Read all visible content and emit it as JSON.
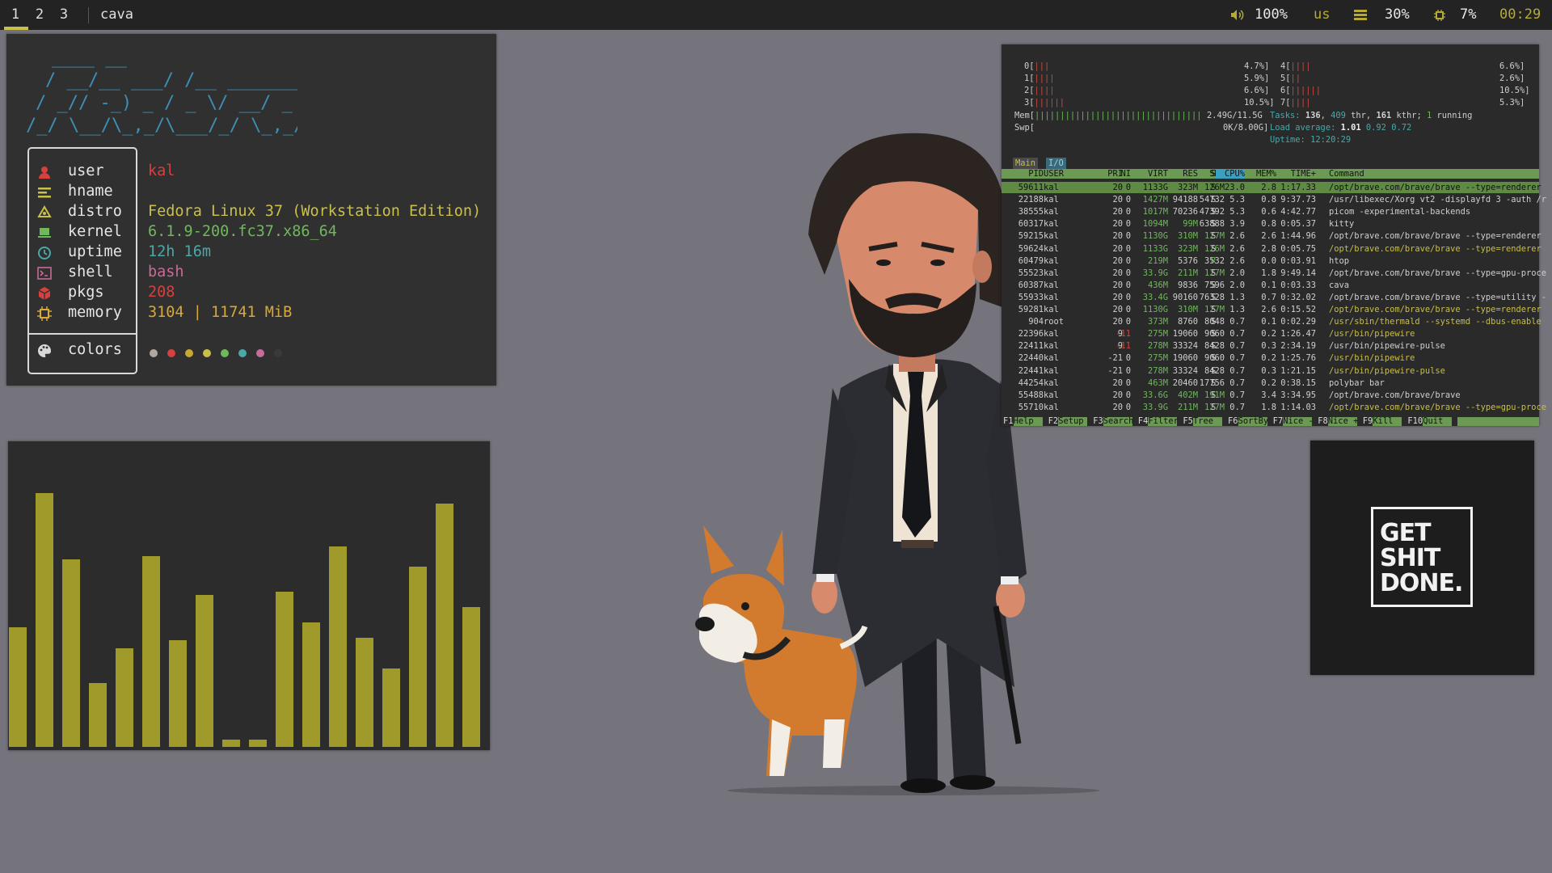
{
  "bar": {
    "workspaces": [
      "1",
      "2",
      "3"
    ],
    "window_title": "cava",
    "volume": "100%",
    "layout": "us",
    "memory": "30%",
    "cpu": "7%",
    "clock": "00:29",
    "accent": "#c9c04a"
  },
  "fetch": {
    "rows": [
      {
        "label": "user",
        "value": "kal",
        "icon": "user-icon",
        "color": "#d5413e"
      },
      {
        "label": "hname",
        "value": "",
        "icon": "hostname-icon",
        "color": "#c9c04a"
      },
      {
        "label": "distro",
        "value": "Fedora Linux 37 (Workstation Edition)",
        "icon": "fedora-icon",
        "color": "#c9c04a"
      },
      {
        "label": "kernel",
        "value": "6.1.9-200.fc37.x86_64",
        "icon": "laptop-icon",
        "color": "#6fb85c"
      },
      {
        "label": "uptime",
        "value": "12h 16m",
        "icon": "clock-icon",
        "color": "#4aa8a8"
      },
      {
        "label": "shell",
        "value": "bash",
        "icon": "terminal-icon",
        "color": "#c76b98"
      },
      {
        "label": "pkgs",
        "value": "208",
        "icon": "package-icon",
        "color": "#d5413e"
      },
      {
        "label": "memory",
        "value": "3104 | 11741 MiB",
        "icon": "chip-icon",
        "color": "#d8a838"
      }
    ],
    "colors_label": "colors",
    "palette": [
      "#b0a8a0",
      "#d5413e",
      "#c9a832",
      "#c9c04a",
      "#6fb85c",
      "#4aa8a8",
      "#c76b98",
      "#3a3a3a"
    ]
  },
  "cava": {
    "bar_color": "#a09a2a",
    "levels": [
      0.47,
      1.0,
      0.74,
      0.25,
      0.39,
      0.75,
      0.42,
      0.6,
      0.03,
      0.03,
      0.61,
      0.49,
      0.79,
      0.43,
      0.31,
      0.71,
      0.96,
      0.55
    ]
  },
  "htop": {
    "cpus": [
      {
        "id": "0",
        "bars": "|||",
        "pct": "4.7%"
      },
      {
        "id": "1",
        "bars": "||||",
        "pct": "5.9%"
      },
      {
        "id": "2",
        "bars": "||||",
        "pct": "6.6%"
      },
      {
        "id": "3",
        "bars": "||||||",
        "pct": "10.5%"
      },
      {
        "id": "4",
        "bars": "||||",
        "pct": "6.6%"
      },
      {
        "id": "5",
        "bars": "||",
        "pct": "2.6%"
      },
      {
        "id": "6",
        "bars": "||||||",
        "pct": "10.5%"
      },
      {
        "id": "7",
        "bars": "||||",
        "pct": "5.3%"
      }
    ],
    "mem_bars": "|||||||||||||||||||||||||||||||||",
    "mem": "2.49G/11.5G",
    "swp": "0K/8.00G",
    "tasks_label": "Tasks:",
    "tasks": "136",
    "thr": "409",
    "kthr": "161",
    "running": "1",
    "load_label": "Load average:",
    "load1": "1.01",
    "load5": "0.92",
    "load15": "0.72",
    "uptime_label": "Uptime:",
    "uptime": "12:20:29",
    "tabs": [
      "Main",
      "I/O"
    ],
    "header": [
      "PID",
      "USER",
      "PRI",
      "NI",
      "VIRT",
      "RES",
      "SHR",
      "S",
      "CPU%",
      "MEM%",
      "TIME+",
      "Command"
    ],
    "rows": [
      [
        "59611",
        "kal",
        "20",
        "0",
        "1133G",
        "323M",
        "126M",
        "S",
        "23.0",
        "2.8",
        "1:17.33",
        "/opt/brave.com/brave/brave --type=renderer"
      ],
      [
        "22188",
        "kal",
        "20",
        "0",
        "1427M",
        "94188",
        "54732",
        "S",
        "5.3",
        "0.8",
        "9:37.73",
        "/usr/libexec/Xorg vt2 -displayfd 3 -auth /r"
      ],
      [
        "38555",
        "kal",
        "20",
        "0",
        "1017M",
        "70236",
        "47392",
        "S",
        "5.3",
        "0.6",
        "4:42.77",
        "picom -experimental-backends"
      ],
      [
        "60317",
        "kal",
        "20",
        "0",
        "1094M",
        "99M",
        "63888",
        "S",
        "3.9",
        "0.8",
        "0:05.37",
        "kitty"
      ],
      [
        "59215",
        "kal",
        "20",
        "0",
        "1130G",
        "310M",
        "127M",
        "S",
        "2.6",
        "2.6",
        "1:44.96",
        "/opt/brave.com/brave/brave --type=renderer"
      ],
      [
        "59624",
        "kal",
        "20",
        "0",
        "1133G",
        "323M",
        "126M",
        "S",
        "2.6",
        "2.8",
        "0:05.75",
        "/opt/brave.com/brave/brave --type=renderer"
      ],
      [
        "60479",
        "kal",
        "20",
        "0",
        "219M",
        "5376",
        "3532",
        "R",
        "2.6",
        "0.0",
        "0:03.91",
        "htop"
      ],
      [
        "55523",
        "kal",
        "20",
        "0",
        "33.9G",
        "211M",
        "127M",
        "S",
        "2.0",
        "1.8",
        "9:49.14",
        "/opt/brave.com/brave/brave --type=gpu-proce"
      ],
      [
        "60387",
        "kal",
        "20",
        "0",
        "436M",
        "9836",
        "7596",
        "S",
        "2.0",
        "0.1",
        "0:03.33",
        "cava"
      ],
      [
        "55933",
        "kal",
        "20",
        "0",
        "33.4G",
        "90160",
        "76328",
        "S",
        "1.3",
        "0.7",
        "0:32.02",
        "/opt/brave.com/brave/brave --type=utility -"
      ],
      [
        "59281",
        "kal",
        "20",
        "0",
        "1130G",
        "310M",
        "127M",
        "S",
        "1.3",
        "2.6",
        "0:15.52",
        "/opt/brave.com/brave/brave --type=renderer"
      ],
      [
        "904",
        "root",
        "20",
        "0",
        "373M",
        "8760",
        "8048",
        "S",
        "0.7",
        "0.1",
        "0:02.29",
        "/usr/sbin/thermald --systemd --dbus-enable"
      ],
      [
        "22396",
        "kal",
        "9",
        "-11",
        "275M",
        "19060",
        "9060",
        "S",
        "0.7",
        "0.2",
        "1:26.47",
        "/usr/bin/pipewire"
      ],
      [
        "22411",
        "kal",
        "9",
        "-11",
        "278M",
        "33324",
        "8428",
        "S",
        "0.7",
        "0.3",
        "2:34.19",
        "/usr/bin/pipewire-pulse"
      ],
      [
        "22440",
        "kal",
        "-21",
        "0",
        "275M",
        "19060",
        "9060",
        "S",
        "0.7",
        "0.2",
        "1:25.76",
        "/usr/bin/pipewire"
      ],
      [
        "22441",
        "kal",
        "-21",
        "0",
        "278M",
        "33324",
        "8428",
        "S",
        "0.7",
        "0.3",
        "1:21.15",
        "/usr/bin/pipewire-pulse"
      ],
      [
        "44254",
        "kal",
        "20",
        "0",
        "463M",
        "20460",
        "17756",
        "S",
        "0.7",
        "0.2",
        "0:38.15",
        "polybar bar"
      ],
      [
        "55488",
        "kal",
        "20",
        "0",
        "33.6G",
        "402M",
        "191M",
        "S",
        "0.7",
        "3.4",
        "3:34.95",
        "/opt/brave.com/brave/brave"
      ],
      [
        "55710",
        "kal",
        "20",
        "0",
        "33.9G",
        "211M",
        "127M",
        "S",
        "0.7",
        "1.8",
        "1:14.03",
        "/opt/brave.com/brave/brave --type=gpu-proce"
      ]
    ],
    "fkeys": [
      [
        "F1",
        "Help"
      ],
      [
        "F2",
        "Setup"
      ],
      [
        "F3",
        "Search"
      ],
      [
        "F4",
        "Filter"
      ],
      [
        "F5",
        "Tree"
      ],
      [
        "F6",
        "SortBy"
      ],
      [
        "F7",
        "Nice -"
      ],
      [
        "F8",
        "Nice +"
      ],
      [
        "F9",
        "Kill"
      ],
      [
        "F10",
        "Quit"
      ]
    ]
  },
  "poster": {
    "lines": [
      "GET",
      "SHIT",
      "DONE."
    ]
  }
}
